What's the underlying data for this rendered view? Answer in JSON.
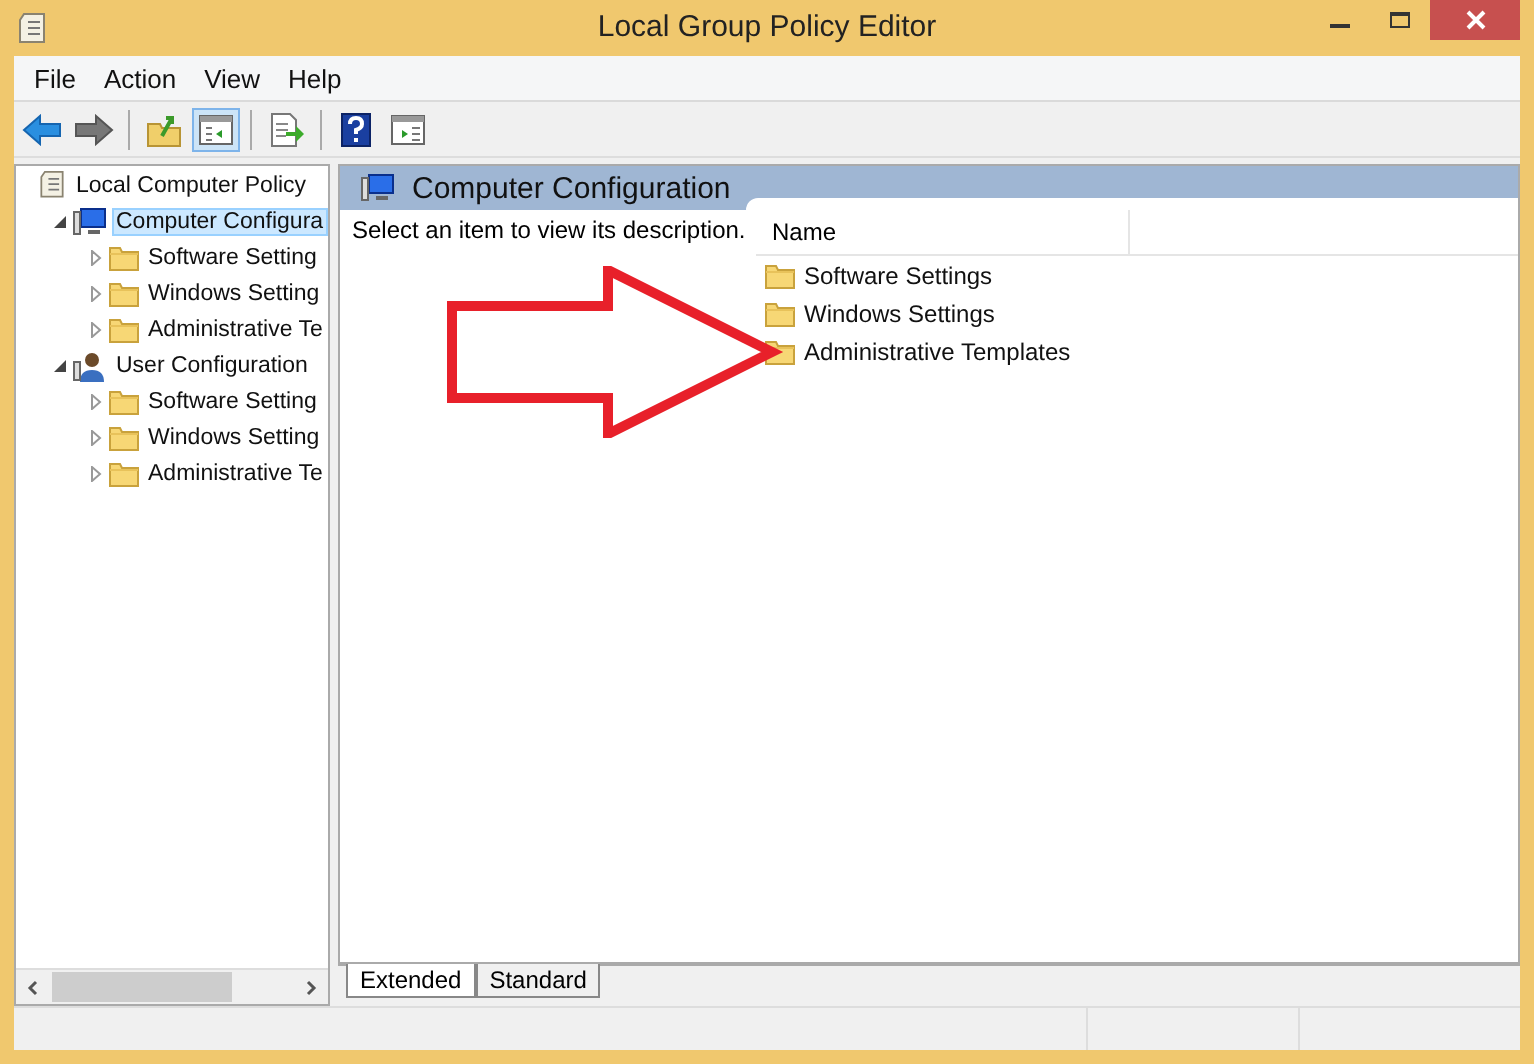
{
  "window": {
    "title": "Local Group Policy Editor"
  },
  "menu": [
    "File",
    "Action",
    "View",
    "Help"
  ],
  "toolbar": [
    {
      "kind": "back",
      "selected": false
    },
    {
      "kind": "forward",
      "selected": false
    },
    {
      "kind": "up",
      "selected": false
    },
    {
      "kind": "tree",
      "selected": true
    },
    {
      "kind": "export",
      "selected": false
    },
    {
      "kind": "help",
      "selected": false
    },
    {
      "kind": "pane",
      "selected": false
    }
  ],
  "tree": [
    {
      "label": "Local Computer Policy",
      "kind": "policy",
      "selected": false,
      "children": [
        {
          "label": "Computer Configura",
          "kind": "computer",
          "selected": true,
          "expanded": true,
          "children": [
            {
              "label": "Software Setting",
              "kind": "folder",
              "selected": false,
              "expanded": false
            },
            {
              "label": "Windows Setting",
              "kind": "folder",
              "selected": false,
              "expanded": false
            },
            {
              "label": "Administrative Te",
              "kind": "folder",
              "selected": false,
              "expanded": false
            }
          ]
        },
        {
          "label": "User Configuration",
          "kind": "user",
          "selected": false,
          "expanded": true,
          "children": [
            {
              "label": "Software Setting",
              "kind": "folder",
              "selected": false,
              "expanded": false
            },
            {
              "label": "Windows Setting",
              "kind": "folder",
              "selected": false,
              "expanded": false
            },
            {
              "label": "Administrative Te",
              "kind": "folder",
              "selected": false,
              "expanded": false
            }
          ]
        }
      ]
    }
  ],
  "details": {
    "title": "Computer Configuration",
    "description": "Select an item to view its description.",
    "columns": [
      "Name"
    ],
    "items": [
      "Software Settings",
      "Windows Settings",
      "Administrative Templates"
    ]
  },
  "tabs": [
    {
      "label": "Extended",
      "selected": true
    },
    {
      "label": "Standard",
      "selected": false
    }
  ]
}
